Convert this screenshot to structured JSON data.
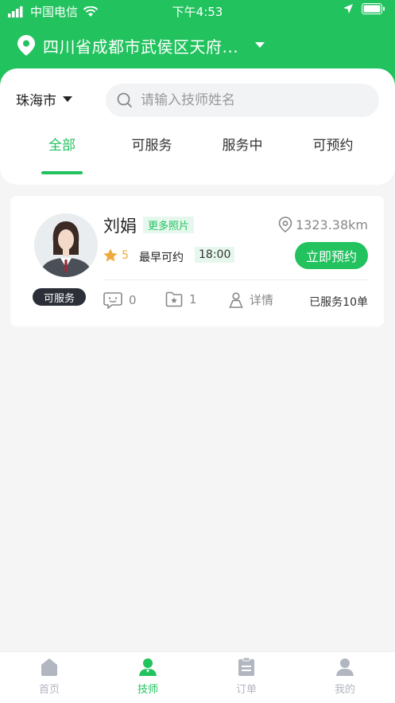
{
  "status_bar": {
    "carrier": "中国电信",
    "time": "下午4:53"
  },
  "location": {
    "address": "四川省成都市武侯区天府..."
  },
  "filter": {
    "city": "珠海市",
    "search_placeholder": "请输入技师姓名"
  },
  "tabs": [
    {
      "label": "全部",
      "active": true
    },
    {
      "label": "可服务",
      "active": false
    },
    {
      "label": "服务中",
      "active": false
    },
    {
      "label": "可预约",
      "active": false
    }
  ],
  "technicians": [
    {
      "name": "刘娟",
      "photo_badge": "更多照片",
      "distance": "1323.38km",
      "rating": "5",
      "earliest_label": "最早可约",
      "earliest_time": "18:00",
      "status": "可服务",
      "book_label": "立即预约",
      "comments": "0",
      "favorites": "1",
      "detail_label": "详情",
      "served": "已服务10单"
    }
  ],
  "tabbar": [
    {
      "label": "首页",
      "icon": "home-icon",
      "active": false
    },
    {
      "label": "技师",
      "icon": "technician-icon",
      "active": true
    },
    {
      "label": "订单",
      "icon": "order-icon",
      "active": false
    },
    {
      "label": "我的",
      "icon": "profile-icon",
      "active": false
    }
  ],
  "colors": {
    "accent": "#22c25e",
    "star": "#f0a83a",
    "badge_dark": "#2c2f38"
  }
}
